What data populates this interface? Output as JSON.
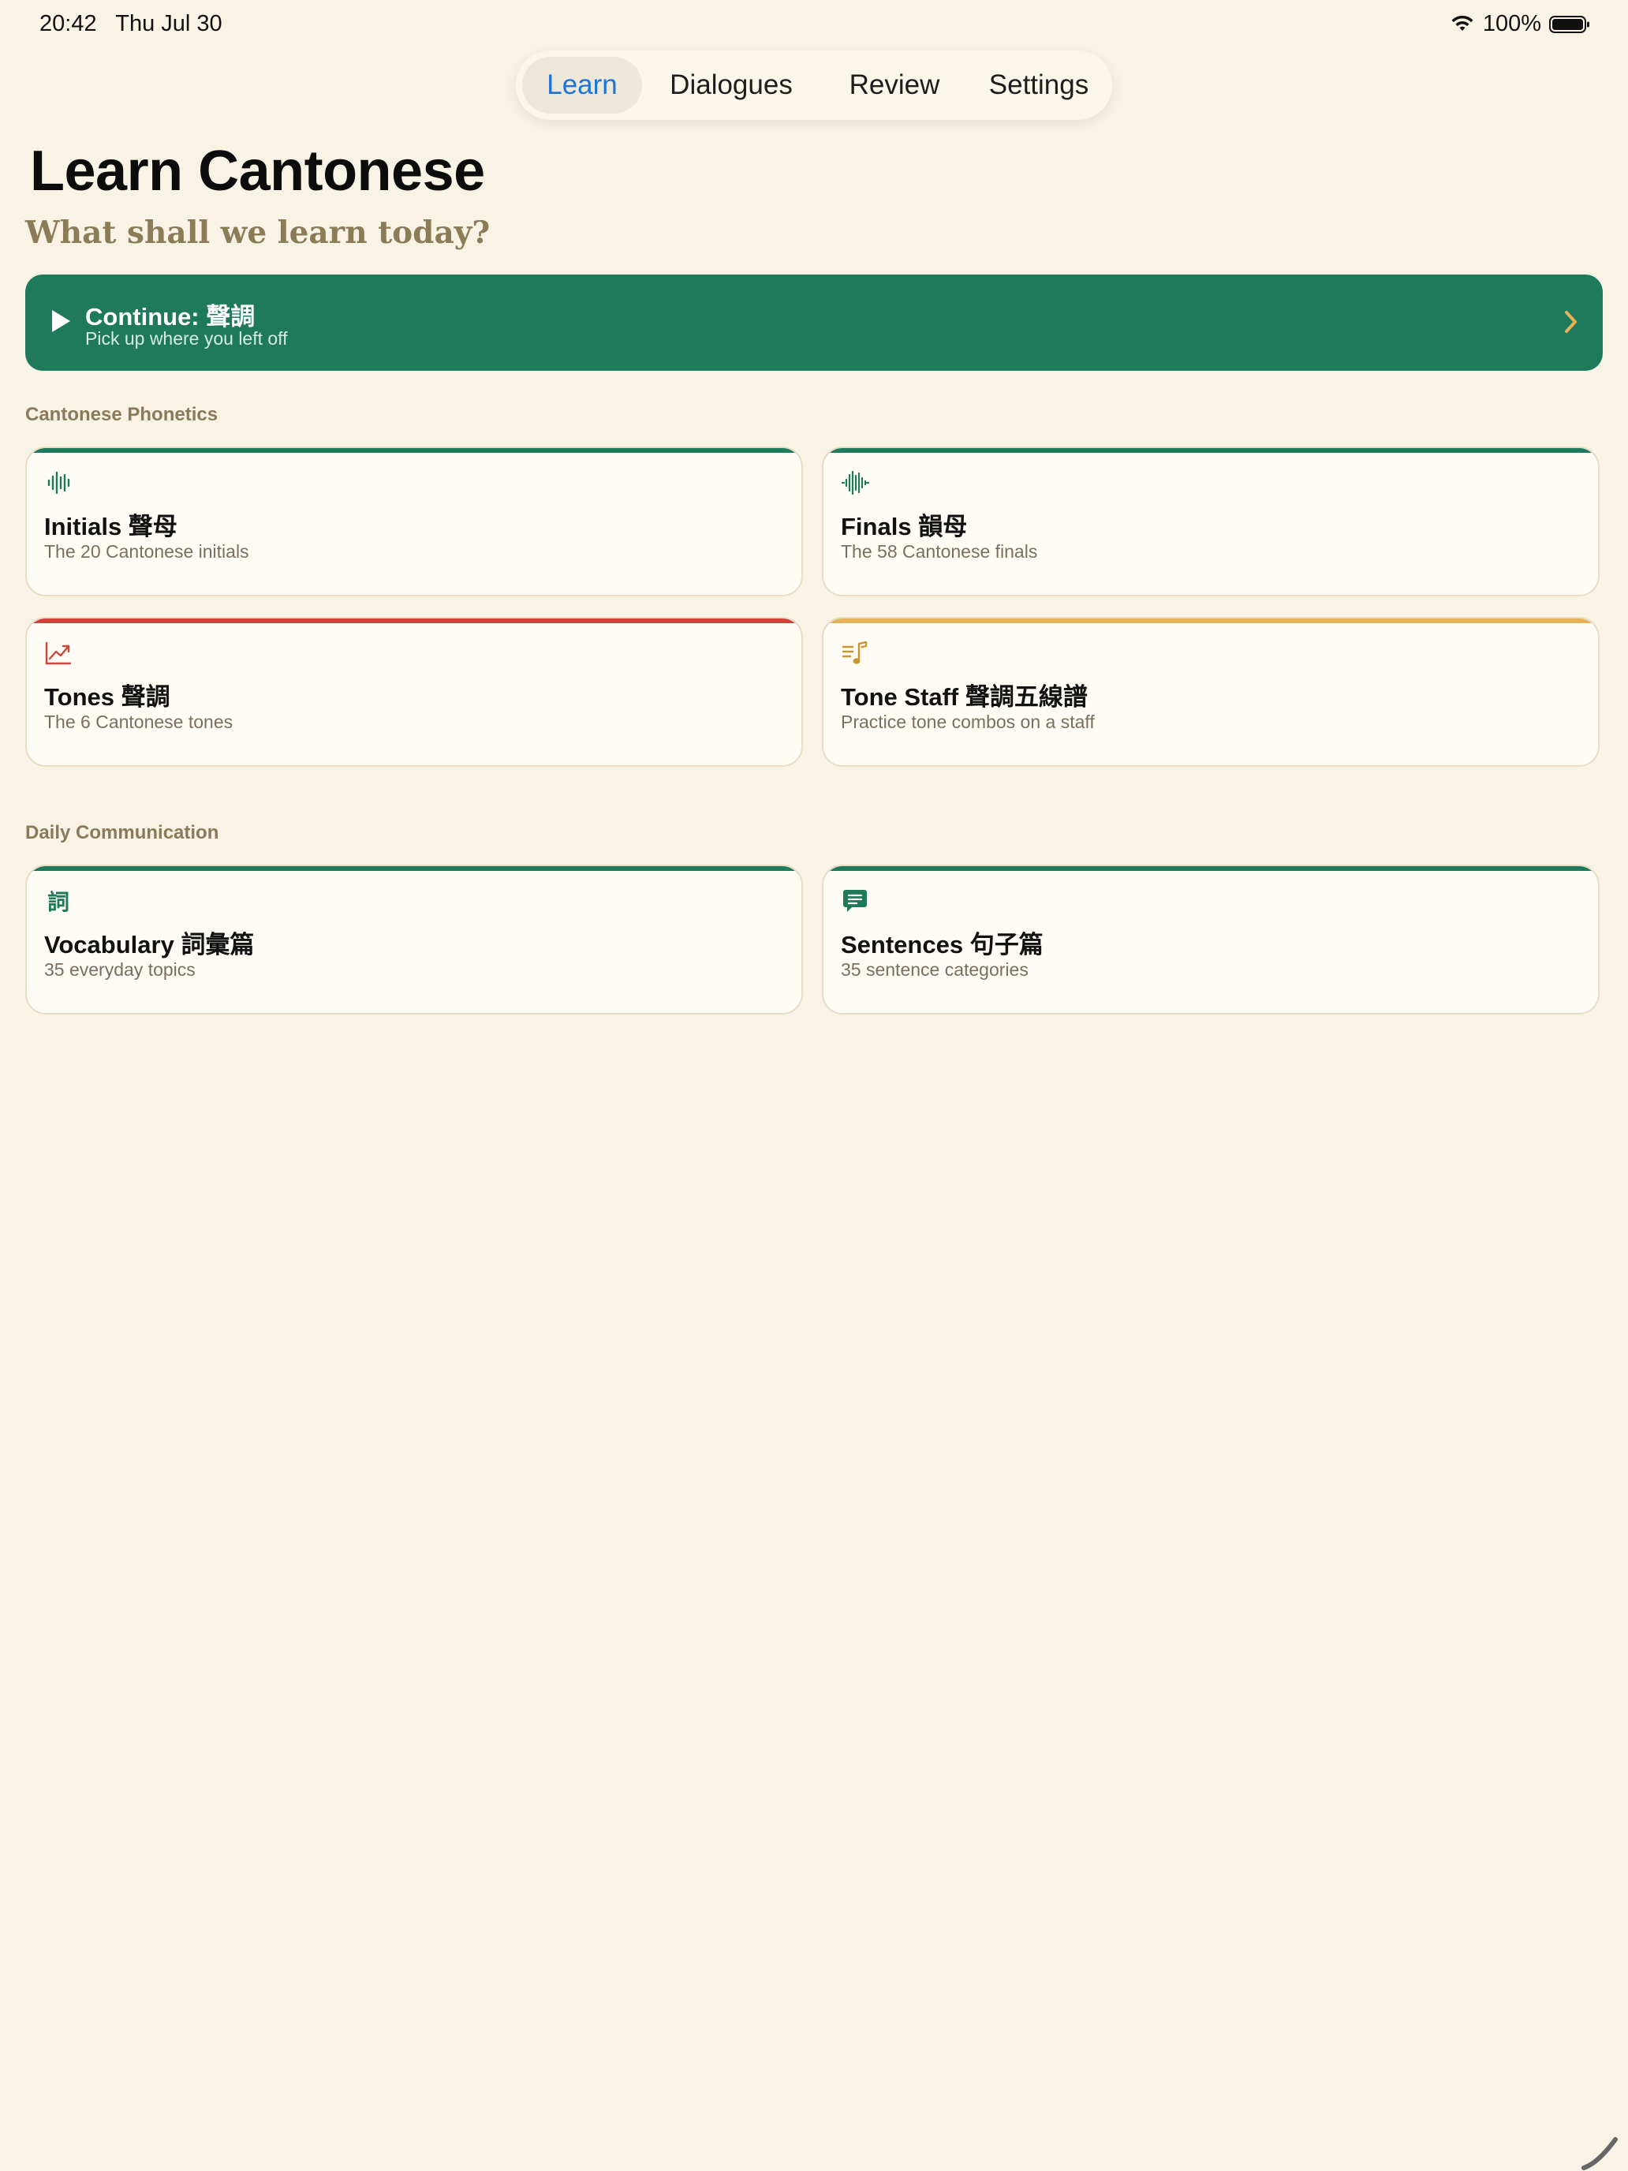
{
  "status_bar": {
    "time": "20:42",
    "date": "Thu Jul 30",
    "battery": "100%"
  },
  "tabs": [
    {
      "label": "Learn",
      "active": true
    },
    {
      "label": "Dialogues",
      "active": false
    },
    {
      "label": "Review",
      "active": false
    },
    {
      "label": "Settings",
      "active": false
    }
  ],
  "page": {
    "title": "Learn Cantonese",
    "subtitle": "What shall we learn today?"
  },
  "continue": {
    "title": "Continue: 聲調",
    "subtitle": "Pick up where you left off"
  },
  "sections": [
    {
      "label": "Cantonese Phonetics",
      "cards": [
        {
          "title": "Initials 聲母",
          "subtitle": "The 20 Cantonese initials",
          "icon": "waveform-icon",
          "accent": "#1f7a5c"
        },
        {
          "title": "Finals 韻母",
          "subtitle": "The 58 Cantonese finals",
          "icon": "waveform-icon",
          "accent": "#1f7a5c"
        },
        {
          "title": "Tones 聲調",
          "subtitle": "The 6 Cantonese tones",
          "icon": "line-chart-icon",
          "accent": "#c8473a"
        },
        {
          "title": "Tone Staff 聲調五線譜",
          "subtitle": "Practice tone combos on a staff",
          "icon": "music-note-list-icon",
          "accent": "#e8b25a"
        }
      ]
    },
    {
      "label": "Daily Communication",
      "cards": [
        {
          "title": "Vocabulary 詞彙篇",
          "subtitle": "35 everyday topics",
          "icon": "word-glyph-icon",
          "icon_text": "詞",
          "accent": "#1f7a5c"
        },
        {
          "title": "Sentences 句子篇",
          "subtitle": "35 sentence categories",
          "icon": "chat-bubble-icon",
          "accent": "#1f7a5c"
        }
      ]
    }
  ],
  "colors": {
    "background": "#f9f3e6",
    "primary_green": "#1f7a5c",
    "tab_active_text": "#1c74d6",
    "red_accent": "#c8473a",
    "gold_accent": "#e8b25a"
  }
}
